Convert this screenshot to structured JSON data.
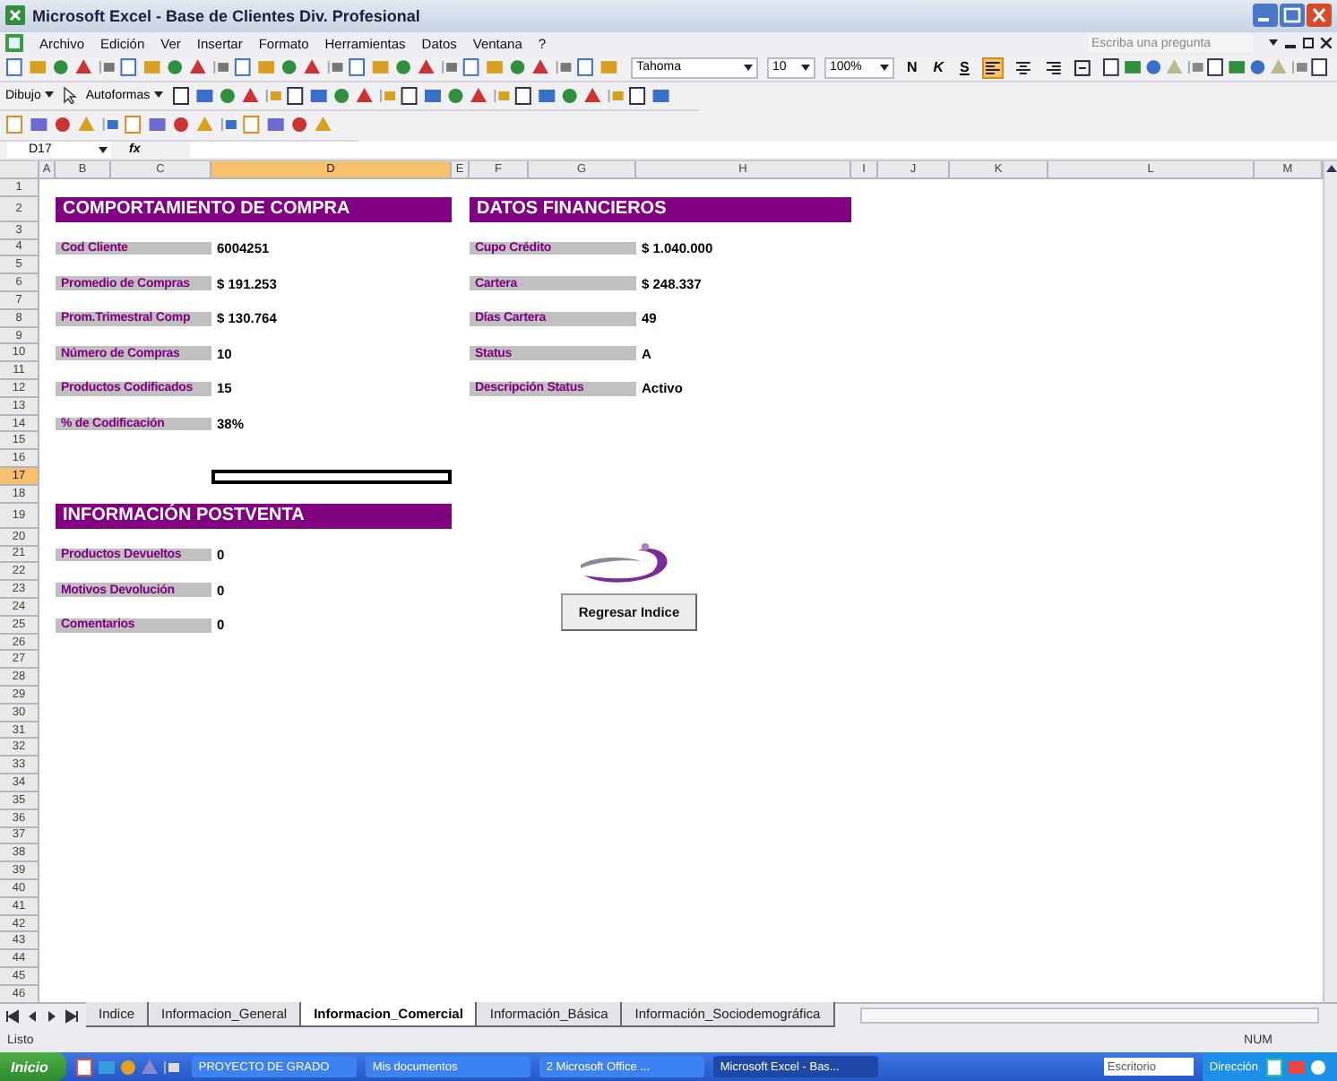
{
  "window": {
    "title": "Microsoft Excel - Base de Clientes Div. Profesional"
  },
  "menu": [
    "Archivo",
    "Edición",
    "Ver",
    "Insertar",
    "Formato",
    "Herramientas",
    "Datos",
    "Ventana",
    "?"
  ],
  "help_search": {
    "placeholder": "Escriba una pregunta"
  },
  "format_toolbar": {
    "font": "Tahoma",
    "size": "10",
    "zoom": "100%",
    "styles": [
      {
        "label": "N",
        "kind": "bold"
      },
      {
        "label": "K",
        "kind": "italic"
      },
      {
        "label": "S",
        "kind": "underline"
      }
    ],
    "alignment": [
      {
        "kind": "left",
        "selected": true
      },
      {
        "kind": "center",
        "selected": false
      },
      {
        "kind": "right",
        "selected": false
      },
      {
        "kind": "merge",
        "selected": false
      }
    ]
  },
  "drawing_toolbar": {
    "menus": [
      "Dibujo",
      "Autoformas"
    ]
  },
  "formula_bar": {
    "name_box": "D17",
    "function_label": "fx"
  },
  "columns": [
    {
      "label": "A",
      "selected": false
    },
    {
      "label": "B",
      "selected": false
    },
    {
      "label": "C",
      "selected": false
    },
    {
      "label": "D",
      "selected": true
    },
    {
      "label": "E",
      "selected": false
    },
    {
      "label": "F",
      "selected": false
    },
    {
      "label": "G",
      "selected": false
    },
    {
      "label": "H",
      "selected": false
    },
    {
      "label": "I",
      "selected": false
    },
    {
      "label": "J",
      "selected": false
    },
    {
      "label": "K",
      "selected": false
    },
    {
      "label": "L",
      "selected": false
    },
    {
      "label": "M",
      "selected": false
    }
  ],
  "rows": [
    {
      "label": "1",
      "selected": false
    },
    {
      "label": "2",
      "selected": false
    },
    {
      "label": "3",
      "selected": false
    },
    {
      "label": "4",
      "selected": false
    },
    {
      "label": "5",
      "selected": false
    },
    {
      "label": "6",
      "selected": false
    },
    {
      "label": "7",
      "selected": false
    },
    {
      "label": "8",
      "selected": false
    },
    {
      "label": "9",
      "selected": false
    },
    {
      "label": "10",
      "selected": false
    },
    {
      "label": "11",
      "selected": false
    },
    {
      "label": "12",
      "selected": false
    },
    {
      "label": "13",
      "selected": false
    },
    {
      "label": "14",
      "selected": false
    },
    {
      "label": "15",
      "selected": false
    },
    {
      "label": "16",
      "selected": false
    },
    {
      "label": "17",
      "selected": true
    },
    {
      "label": "18",
      "selected": false
    },
    {
      "label": "19",
      "selected": false
    },
    {
      "label": "20",
      "selected": false
    },
    {
      "label": "21",
      "selected": false
    },
    {
      "label": "22",
      "selected": false
    },
    {
      "label": "23",
      "selected": false
    },
    {
      "label": "24",
      "selected": false
    },
    {
      "label": "25",
      "selected": false
    },
    {
      "label": "26",
      "selected": false
    },
    {
      "label": "27",
      "selected": false
    },
    {
      "label": "28",
      "selected": false
    },
    {
      "label": "29",
      "selected": false
    },
    {
      "label": "30",
      "selected": false
    },
    {
      "label": "31",
      "selected": false
    },
    {
      "label": "32",
      "selected": false
    },
    {
      "label": "33",
      "selected": false
    },
    {
      "label": "34",
      "selected": false
    },
    {
      "label": "35",
      "selected": false
    },
    {
      "label": "36",
      "selected": false
    },
    {
      "label": "37",
      "selected": false
    },
    {
      "label": "38",
      "selected": false
    },
    {
      "label": "39",
      "selected": false
    },
    {
      "label": "40",
      "selected": false
    },
    {
      "label": "41",
      "selected": false
    },
    {
      "label": "42",
      "selected": false
    },
    {
      "label": "43",
      "selected": false
    },
    {
      "label": "44",
      "selected": false
    },
    {
      "label": "45",
      "selected": false
    },
    {
      "label": "46",
      "selected": false
    }
  ],
  "sections": [
    {
      "title": "COMPORTAMIENTO DE COMPRA",
      "fields": [
        {
          "label": "Cod Cliente",
          "value": "6004251"
        },
        {
          "label": "Promedio de Compras",
          "value": "$ 191.253"
        },
        {
          "label": "Prom.Trimestral Comp",
          "value": "$ 130.764"
        },
        {
          "label": "Número de Compras",
          "value": "10"
        },
        {
          "label": "Productos Codificados",
          "value": "15"
        },
        {
          "label": "% de Codificación",
          "value": "38%"
        }
      ]
    },
    {
      "title": "DATOS FINANCIEROS",
      "fields": [
        {
          "label": "Cupo Crédito",
          "value": "$ 1.040.000"
        },
        {
          "label": "Cartera",
          "value": "$ 248.337"
        },
        {
          "label": "Días Cartera",
          "value": "49"
        },
        {
          "label": "Status",
          "value": "A"
        },
        {
          "label": "Descripción Status",
          "value": "Activo"
        }
      ]
    },
    {
      "title": "INFORMACIÓN POSTVENTA",
      "fields": [
        {
          "label": "Productos Devueltos",
          "value": "0"
        },
        {
          "label": "Motivos Devolución",
          "value": "0"
        },
        {
          "label": "Comentarios",
          "value": "0"
        }
      ]
    }
  ],
  "button": "Regresar Indice",
  "sheet_tabs": [
    {
      "label": "Indice",
      "selected": false
    },
    {
      "label": "Informacion_General",
      "selected": false
    },
    {
      "label": "Informacion_Comercial",
      "selected": true
    },
    {
      "label": "Información_Básica",
      "selected": false
    },
    {
      "label": "Información_Sociodemográfica",
      "selected": false
    }
  ],
  "status_bar": {
    "left": "Listo",
    "right": "NUM"
  },
  "taskbar": {
    "start": "Inicio",
    "items": [
      {
        "label": "PROYECTO DE GRADO",
        "selected": false
      },
      {
        "label": "Mis documentos",
        "selected": false
      },
      {
        "label": "2 Microsoft Office ...",
        "selected": false
      },
      {
        "label": "Microsoft Excel - Bas...",
        "selected": true
      }
    ],
    "search": "Escritorio",
    "address": "Dirección"
  }
}
